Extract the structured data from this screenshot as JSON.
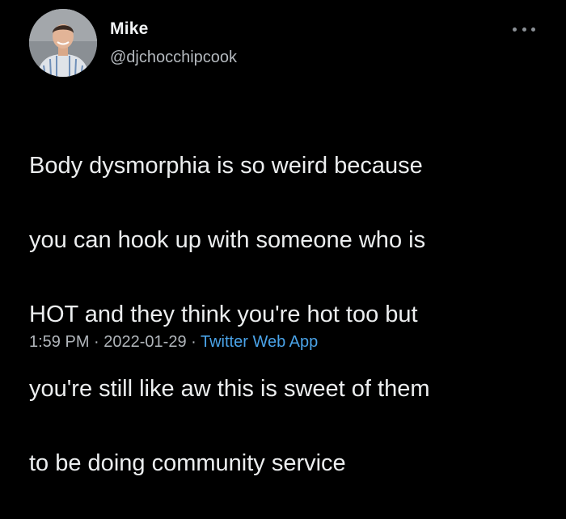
{
  "author": {
    "name": "Mike",
    "handle": "@djchocchipcook",
    "avatar_icon": "profile-photo"
  },
  "menu": {
    "icon": "more-options-icon"
  },
  "tweet": {
    "lines": [
      "Body dysmorphia is so weird because",
      "you can hook up with someone who is",
      "HOT and they think you're hot too but",
      "you're still like aw this is sweet of them",
      "to be doing community service"
    ]
  },
  "meta": {
    "time": "1:59 PM",
    "separator": "·",
    "date": "2022-01-29",
    "source": "Twitter Web App"
  },
  "colors": {
    "background": "#000000",
    "text": "#eceeef",
    "secondary": "#b0b5ba",
    "link": "#4aa3e8"
  }
}
